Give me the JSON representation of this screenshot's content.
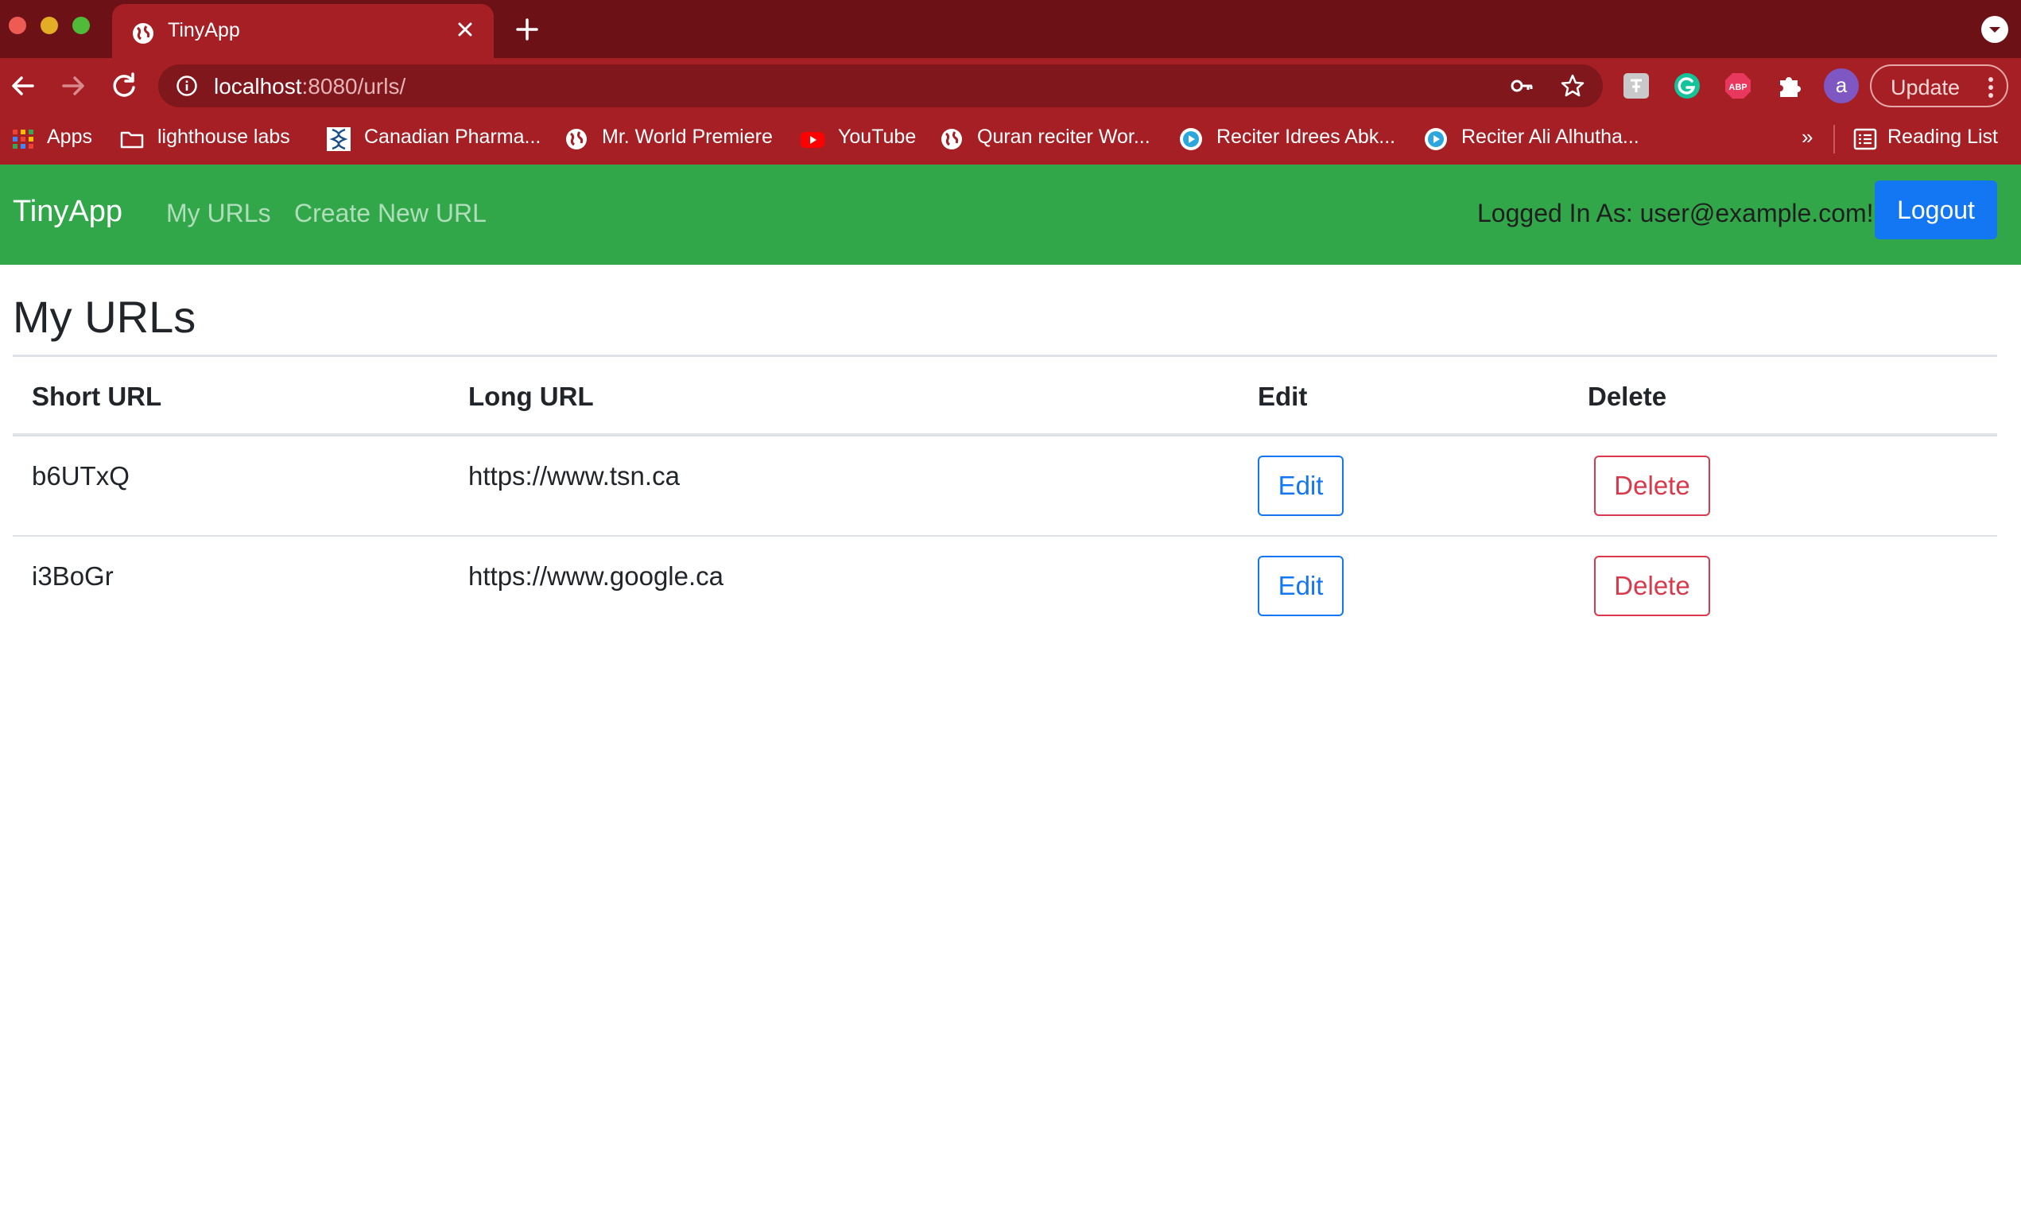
{
  "browser": {
    "tab_title": "TinyApp",
    "url_host": "localhost",
    "url_rest": ":8080/urls/",
    "update_label": "Update",
    "profile_initial": "a",
    "bookmarks": [
      {
        "label": "Apps",
        "icon": "apps-grid-icon"
      },
      {
        "label": "lighthouse labs",
        "icon": "folder-icon"
      },
      {
        "label": "Canadian Pharma...",
        "icon": "dna-icon"
      },
      {
        "label": "Mr. World Premiere",
        "icon": "globe-icon"
      },
      {
        "label": "YouTube",
        "icon": "youtube-icon"
      },
      {
        "label": "Quran reciter Wor...",
        "icon": "globe-icon"
      },
      {
        "label": "Reciter Idrees Abk...",
        "icon": "play-circle-icon"
      },
      {
        "label": "Reciter Ali Alhutha...",
        "icon": "play-circle-icon"
      }
    ],
    "more_bookmarks": "»",
    "reading_list": "Reading List",
    "colors": {
      "tabbar": "#6c1216",
      "toolbar": "#a51f24"
    }
  },
  "navbar": {
    "brand": "TinyApp",
    "links": [
      "My URLs",
      "Create New URL"
    ],
    "logged_in_text": "Logged In As: user@example.com!",
    "logout_label": "Logout",
    "color": "#31a74a"
  },
  "main": {
    "title": "My URLs",
    "table": {
      "headers": [
        "Short URL",
        "Long URL",
        "Edit",
        "Delete"
      ],
      "rows": [
        {
          "short": "b6UTxQ",
          "long": "https://www.tsn.ca",
          "edit": "Edit",
          "delete": "Delete"
        },
        {
          "short": "i3BoGr",
          "long": "https://www.google.ca",
          "edit": "Edit",
          "delete": "Delete"
        }
      ]
    }
  }
}
